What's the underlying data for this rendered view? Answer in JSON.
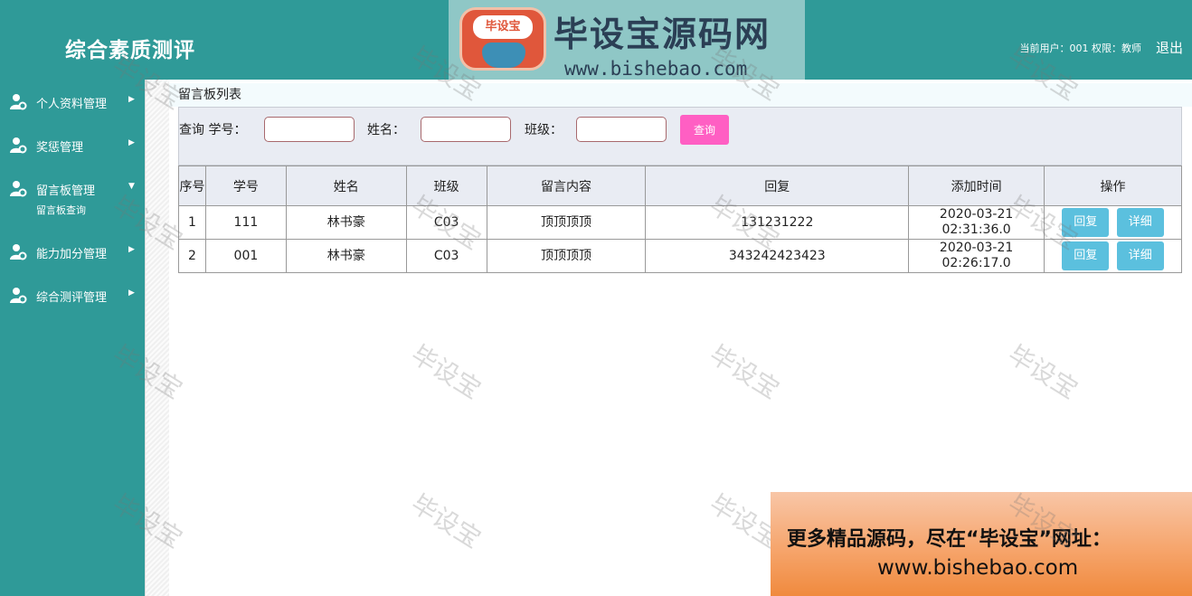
{
  "header": {
    "title": "综合素质测评",
    "user_info": "当前用户：001 权限：教师",
    "logout_label": "退出"
  },
  "brand": {
    "logo_text": "毕设宝",
    "name": "毕设宝源码网",
    "url": "www.bishebao.com"
  },
  "sidebar": {
    "items": [
      {
        "label": "个人资料管理",
        "icon": "user-gear-icon",
        "expanded": false
      },
      {
        "label": "奖惩管理",
        "icon": "user-gear-icon",
        "expanded": false
      },
      {
        "label": "留言板管理",
        "icon": "user-gear-icon",
        "expanded": true
      },
      {
        "label": "能力加分管理",
        "icon": "user-gear-icon",
        "expanded": false
      },
      {
        "label": "综合测评管理",
        "icon": "user-gear-icon",
        "expanded": false
      }
    ],
    "submenu": {
      "label": "留言板查询"
    }
  },
  "breadcrumb": "留言板列表",
  "search": {
    "query_label": "查询 学号：",
    "name_label": "姓名：",
    "class_label": "班级：",
    "button_label": "查询",
    "student_id_value": "",
    "name_value": "",
    "class_value": ""
  },
  "table": {
    "headers": [
      "序号",
      "学号",
      "姓名",
      "班级",
      "留言内容",
      "回复",
      "添加时间",
      "操作"
    ],
    "rows": [
      {
        "seq": "1",
        "student_id": "111",
        "name": "林书豪",
        "class": "C03",
        "content": "顶顶顶顶",
        "reply": "131231222",
        "added_date": "2020-03-21",
        "added_time": "02:31:36.0",
        "reply_btn": "回复",
        "detail_btn": "详细"
      },
      {
        "seq": "2",
        "student_id": "001",
        "name": "林书豪",
        "class": "C03",
        "content": "顶顶顶顶",
        "reply": "343242423423",
        "added_date": "2020-03-21",
        "added_time": "02:26:17.0",
        "reply_btn": "回复",
        "detail_btn": "详细"
      }
    ]
  },
  "watermark_text": "毕设宝",
  "ad": {
    "line1": "更多精品源码，尽在“毕设宝”网址：",
    "line2": "www.bishebao.com"
  },
  "colors": {
    "primary": "#2f9a98",
    "search_button": "#ff5fc3",
    "action_button": "#5bc0de"
  }
}
